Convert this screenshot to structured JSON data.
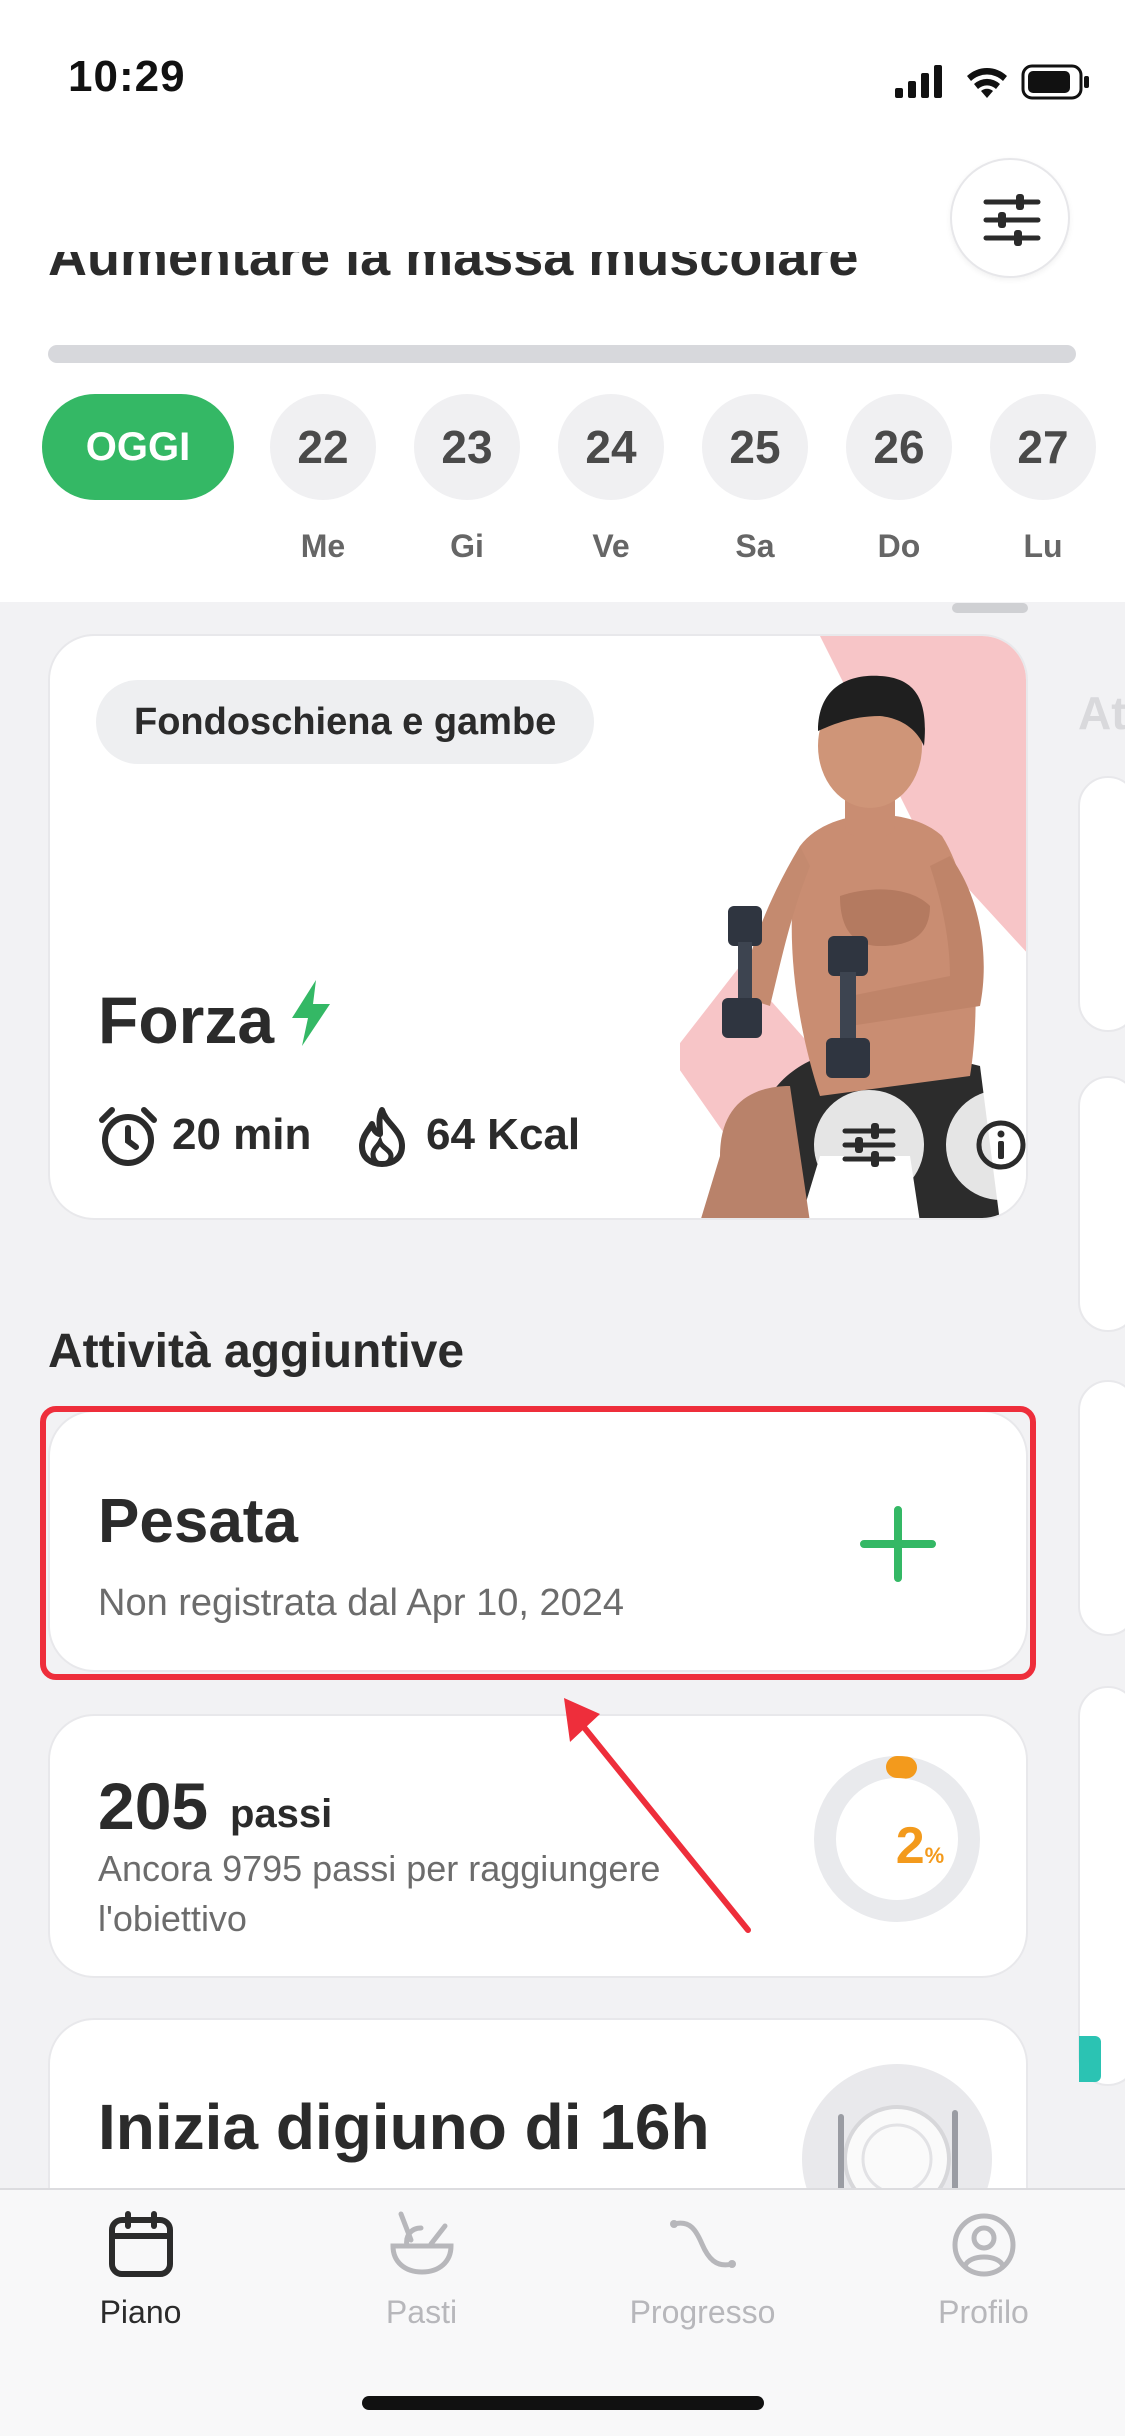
{
  "status": {
    "time": "10:29"
  },
  "header": {
    "goal_title": "Aumentare la massa muscolare",
    "filter_icon": "sliders-icon"
  },
  "days": {
    "today": "OGGI",
    "items": [
      {
        "num": "22",
        "label": "Me"
      },
      {
        "num": "23",
        "label": "Gi"
      },
      {
        "num": "24",
        "label": "Ve"
      },
      {
        "num": "25",
        "label": "Sa"
      },
      {
        "num": "26",
        "label": "Do"
      },
      {
        "num": "27",
        "label": "Lu"
      }
    ]
  },
  "workout": {
    "tag": "Fondoschiena e gambe",
    "title": "Forza",
    "duration": "20 min",
    "calories": "64 Kcal"
  },
  "side_peek_text": "At",
  "extra": {
    "section_title": "Attività aggiuntive",
    "weigh": {
      "title": "Pesata",
      "subtitle": "Non registrata dal Apr 10, 2024"
    },
    "steps": {
      "count": "205",
      "unit": "passi",
      "subtitle": "Ancora 9795 passi per raggiungere l'obiettivo",
      "percent": "2",
      "percent_unit": "%",
      "progress_fraction": 0.02
    },
    "fasting": {
      "title": "Inizia digiuno di 16h"
    }
  },
  "tabs": [
    {
      "label": "Piano",
      "icon": "calendar-icon",
      "active": true
    },
    {
      "label": "Pasti",
      "icon": "bowl-icon",
      "active": false
    },
    {
      "label": "Progresso",
      "icon": "progress-curve-icon",
      "active": false
    },
    {
      "label": "Profilo",
      "icon": "profile-icon",
      "active": false
    }
  ],
  "colors": {
    "accent": "#34b865",
    "highlight": "#ee2e3b",
    "steps_ring": "#f39a1c"
  }
}
